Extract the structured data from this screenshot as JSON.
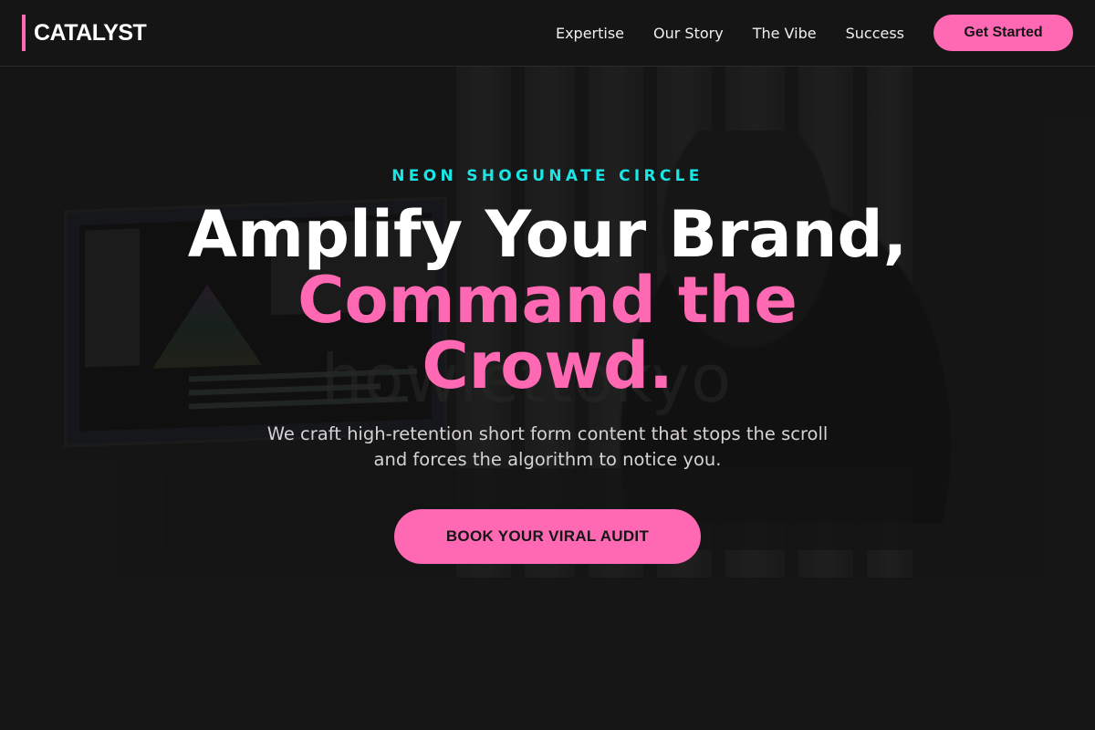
{
  "nav": {
    "brand": "CATALYST",
    "links": [
      "Expertise",
      "Our Story",
      "The Vibe",
      "Success"
    ],
    "cta_label": "Get Started"
  },
  "hero": {
    "eyebrow": "NEON SHOGUNATE CIRCLE",
    "headline_line1": "Amplify Your Brand,",
    "headline_line2": "Command the",
    "headline_line3": "Crowd.",
    "subtext": "We craft high-retention short form content that stops the scroll and forces the algorithm to notice you.",
    "cta_label": "BOOK YOUR VIRAL AUDIT",
    "background_watermark": "howlettokyo"
  },
  "colors": {
    "accent": "#ff69b4",
    "eyebrow": "#19e6e6",
    "nav_background": "#151515",
    "page_background": "#141414"
  }
}
